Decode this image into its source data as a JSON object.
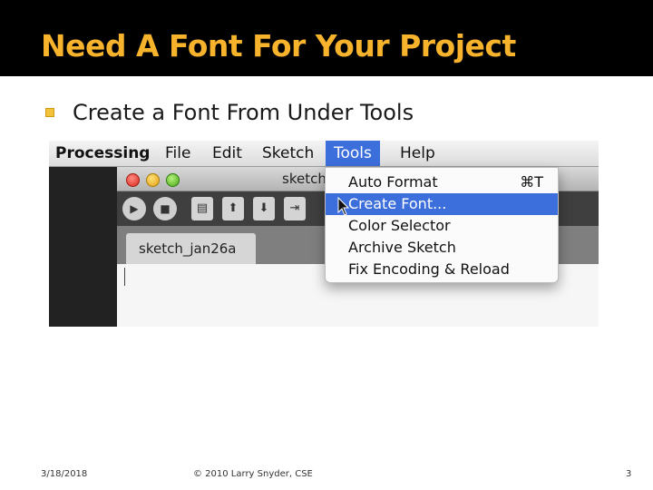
{
  "slide": {
    "title": "Need A Font For Your Project",
    "bullet": "Create a Font From Under Tools",
    "footer": {
      "date": "3/18/2018",
      "copyright": "© 2010 Larry Snyder, CSE",
      "page": "3"
    }
  },
  "screenshot": {
    "menubar": {
      "app": "Processing",
      "file": "File",
      "edit": "Edit",
      "sketch": "Sketch",
      "tools": "Tools",
      "help": "Help"
    },
    "window": {
      "title": "sketch",
      "tab": "sketch_jan26a"
    },
    "tools_menu": [
      {
        "label": "Auto Format",
        "shortcut": "⌘T"
      },
      {
        "label": "Create Font...",
        "shortcut": ""
      },
      {
        "label": "Color Selector",
        "shortcut": ""
      },
      {
        "label": "Archive Sketch",
        "shortcut": ""
      },
      {
        "label": "Fix Encoding & Reload",
        "shortcut": ""
      }
    ],
    "highlighted_item": "Create Font..."
  },
  "colors": {
    "title_text": "#f7b32b",
    "title_bar": "#000000",
    "menu_highlight": "#3d6fdc",
    "bullet": "#f2c23a"
  },
  "icons": [
    "run-icon",
    "stop-icon",
    "new-icon",
    "open-icon",
    "save-icon",
    "export-icon",
    "mouse-pointer-icon"
  ]
}
